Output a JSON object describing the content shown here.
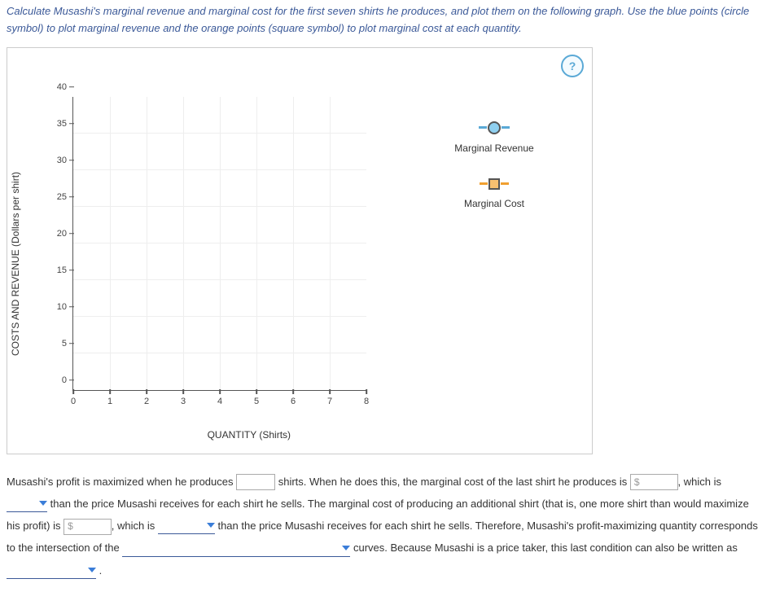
{
  "instructions": "Calculate Musashi's marginal revenue and marginal cost for the first seven shirts he produces, and plot them on the following graph. Use the blue points (circle symbol) to plot marginal revenue and the orange points (square symbol) to plot marginal cost at each quantity.",
  "help_label": "?",
  "chart_data": {
    "type": "scatter",
    "title": "",
    "xlabel": "QUANTITY (Shirts)",
    "ylabel": "COSTS AND REVENUE (Dollars per shirt)",
    "x_ticks": [
      0,
      1,
      2,
      3,
      4,
      5,
      6,
      7,
      8
    ],
    "y_ticks": [
      0,
      5,
      10,
      15,
      20,
      25,
      30,
      35,
      40
    ],
    "xlim": [
      0,
      8
    ],
    "ylim": [
      0,
      40
    ],
    "series": [
      {
        "name": "Marginal Revenue",
        "symbol": "circle",
        "color": "#5aa9d6",
        "values": []
      },
      {
        "name": "Marginal Cost",
        "symbol": "square",
        "color": "#f0a030",
        "values": []
      }
    ]
  },
  "legend": {
    "mr": "Marginal Revenue",
    "mc": "Marginal Cost"
  },
  "answer": {
    "part1": "Musashi's profit is maximized when he produces ",
    "part2": " shirts. When he does this, the marginal cost of the last shirt he produces is ",
    "part3": ", which is ",
    "part4": " than the price Musashi receives for each shirt he sells. The marginal cost of producing an additional shirt (that is, one more shirt than would maximize his profit) is ",
    "part5": ", which is ",
    "part6": " than the price Musashi receives for each shirt he sells. Therefore, Musashi's profit-maximizing quantity corresponds to the intersection of the ",
    "part7": " curves. Because Musashi is a price taker, this last condition can also be written as ",
    "part8": "."
  },
  "placeholders": {
    "dollar": "$"
  }
}
